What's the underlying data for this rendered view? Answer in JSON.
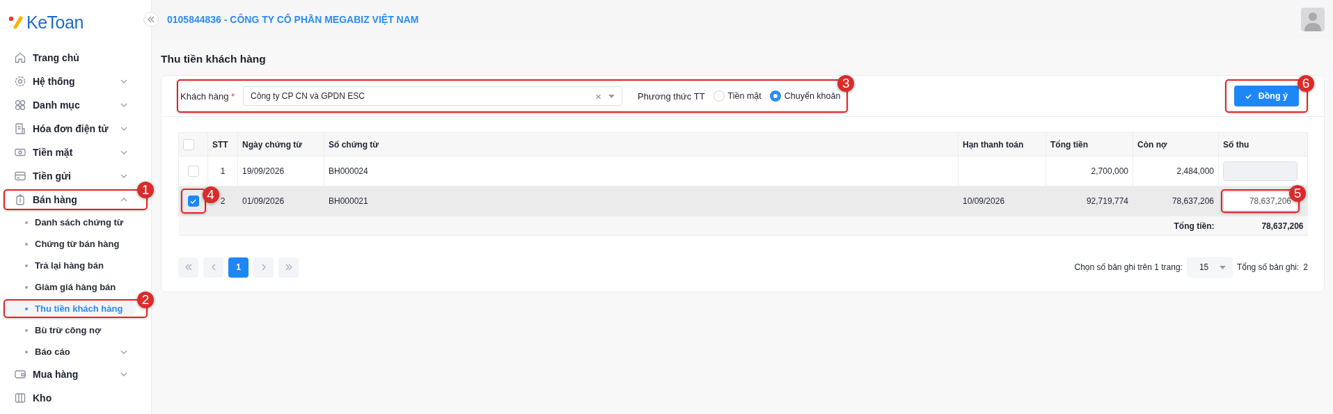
{
  "brand": {
    "name": "KeToan"
  },
  "header": {
    "company": "0105844836 - CÔNG TY CỔ PHẦN MEGABIZ VIỆT NAM"
  },
  "sidebar": {
    "items": [
      {
        "label": "Trang chủ",
        "kind": "link"
      },
      {
        "label": "Hệ thống",
        "kind": "group",
        "expanded": false
      },
      {
        "label": "Danh mục",
        "kind": "group",
        "expanded": false
      },
      {
        "label": "Hóa đơn điện tử",
        "kind": "group",
        "expanded": false
      },
      {
        "label": "Tiền mặt",
        "kind": "group",
        "expanded": false
      },
      {
        "label": "Tiền gửi",
        "kind": "group",
        "expanded": false
      },
      {
        "label": "Bán hàng",
        "kind": "group",
        "expanded": true,
        "annotation": "1",
        "children": [
          {
            "label": "Danh sách chứng từ",
            "kind": "link",
            "selected": false
          },
          {
            "label": "Chứng từ bán hàng",
            "kind": "link",
            "selected": false
          },
          {
            "label": "Trả lại hàng bán",
            "kind": "link",
            "selected": false
          },
          {
            "label": "Giảm giá hàng bán",
            "kind": "link",
            "selected": false
          },
          {
            "label": "Thu tiền khách hàng",
            "kind": "link",
            "selected": true,
            "annotation": "2"
          },
          {
            "label": "Bù trừ công nợ",
            "kind": "link",
            "selected": false
          },
          {
            "label": "Báo cáo",
            "kind": "group",
            "selected": false,
            "expanded": false
          }
        ]
      },
      {
        "label": "Mua hàng",
        "kind": "group",
        "expanded": false
      },
      {
        "label": "Kho",
        "kind": "link"
      }
    ]
  },
  "page": {
    "title": "Thu tiền khách hàng"
  },
  "filter": {
    "annotation": "3",
    "customer_label": "Khách hàng",
    "required_mark": "*",
    "customer_value": "Công ty CP CN và GPDN ESC",
    "clear_symbol": "×",
    "payment_label": "Phương thức TT",
    "payment_options": [
      {
        "label": "Tiền mặt",
        "selected": false
      },
      {
        "label": "Chuyển khoản",
        "selected": true
      }
    ]
  },
  "confirm_button": {
    "label": "Đồng ý",
    "annotation": "6"
  },
  "table": {
    "header_checked": false,
    "columns": [
      "STT",
      "Ngày chứng từ",
      "Số chứng từ",
      "Hạn thanh toán",
      "Tổng tiền",
      "Còn nợ",
      "Số thu"
    ],
    "rows": [
      {
        "checked": false,
        "selected": false,
        "cells": [
          "1",
          "19/09/2026",
          "BH000024",
          "",
          "2,700,000",
          "2,484,000"
        ],
        "amount": {
          "disabled": true
        }
      },
      {
        "checked": true,
        "selected": true,
        "check_annotation": "4",
        "cells": [
          "2",
          "01/09/2026",
          "BH000021",
          "10/09/2026",
          "92,719,774",
          "78,637,206"
        ],
        "amount": {
          "value": "78,637,206",
          "disabled": false,
          "annotation": "5"
        }
      }
    ],
    "footer": {
      "label": "Tổng tiền:",
      "value": "78,637,206"
    }
  },
  "pagination": {
    "pages": [
      {
        "label": "1",
        "selected": true
      }
    ],
    "page_size_label": "Chọn số bản ghi trên 1 trang:",
    "page_size": "15",
    "total_label": "Tổng số bản ghi:",
    "total": "2"
  }
}
